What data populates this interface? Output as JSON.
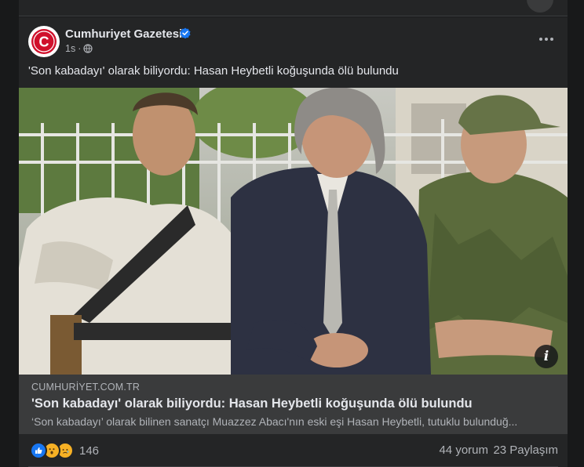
{
  "post": {
    "page_name": "Cumhuriyet Gazetesi",
    "time": "1s",
    "time_separator": "·",
    "text": "'Son kabadayı' olarak biliyordu: Hasan Heybetli koğuşunda ölü bulundu",
    "avatar_letter": "C"
  },
  "link": {
    "domain": "CUMHURİYET.COM.TR",
    "title": "'Son kabadayı' olarak biliyordu: Hasan Heybetli koğuşunda ölü bulundu",
    "description": "‘Son kabadayı’ olarak bilinen sanatçı Muazzez Abacı'nın eski eşi Hasan Heybetli, tutuklu bulunduğ..."
  },
  "stats": {
    "reaction_count": "146",
    "comments": "44 yorum",
    "shares": "23 Paylaşım"
  },
  "icons": {
    "verified": "verified-badge-icon",
    "privacy": "globe-icon",
    "more": "more-options-icon",
    "info": "info-icon",
    "reactions": [
      "like-reaction-icon",
      "wow-reaction-icon",
      "sad-reaction-icon"
    ]
  },
  "colors": {
    "background": "#18191a",
    "card": "#242526",
    "link_box": "#3a3b3c",
    "brand_red": "#d0102b",
    "verified_blue": "#1877f2"
  }
}
